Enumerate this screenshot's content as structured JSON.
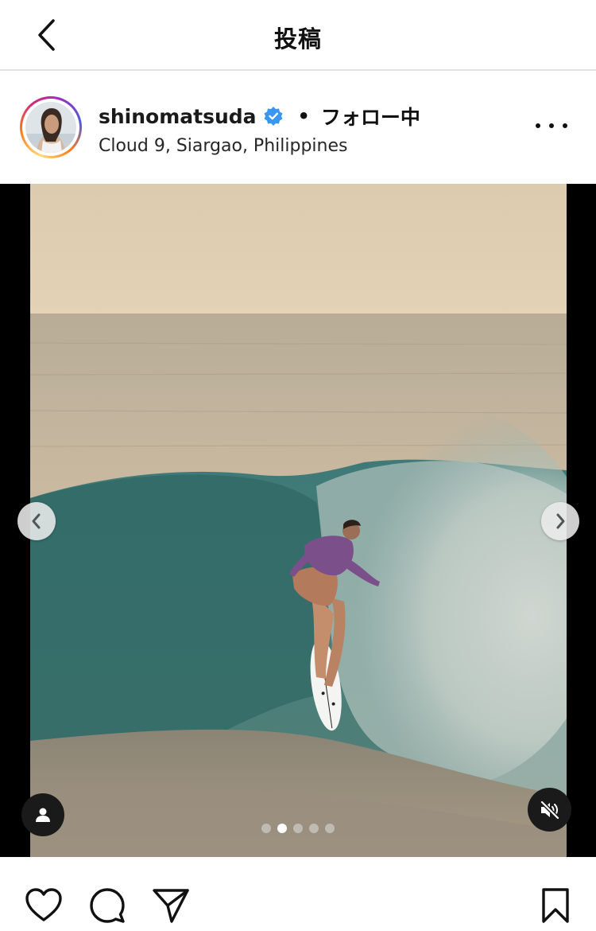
{
  "topbar": {
    "title": "投稿",
    "back_icon": "chevron-left-icon"
  },
  "post": {
    "username": "shinomatsuda",
    "verified": true,
    "separator": "•",
    "follow_status": "フォロー中",
    "location": "Cloud 9, Siargao, Philippines",
    "more_icon": "more-horizontal-icon",
    "avatar_ring_colors": [
      "#feda75",
      "#fa7e1e",
      "#d62976",
      "#962fbf",
      "#4f5bd5"
    ],
    "verified_color": "#3897f0"
  },
  "media": {
    "description_icon": "photo",
    "carousel": {
      "count": 5,
      "active_index": 1
    },
    "prev_icon": "chevron-left-icon",
    "next_icon": "chevron-right-icon",
    "tag_icon": "user-tag-icon",
    "mute_icon": "speaker-muted-icon"
  },
  "actions": {
    "like_icon": "heart-icon",
    "comment_icon": "comment-bubble-icon",
    "share_icon": "send-icon",
    "save_icon": "bookmark-icon"
  }
}
